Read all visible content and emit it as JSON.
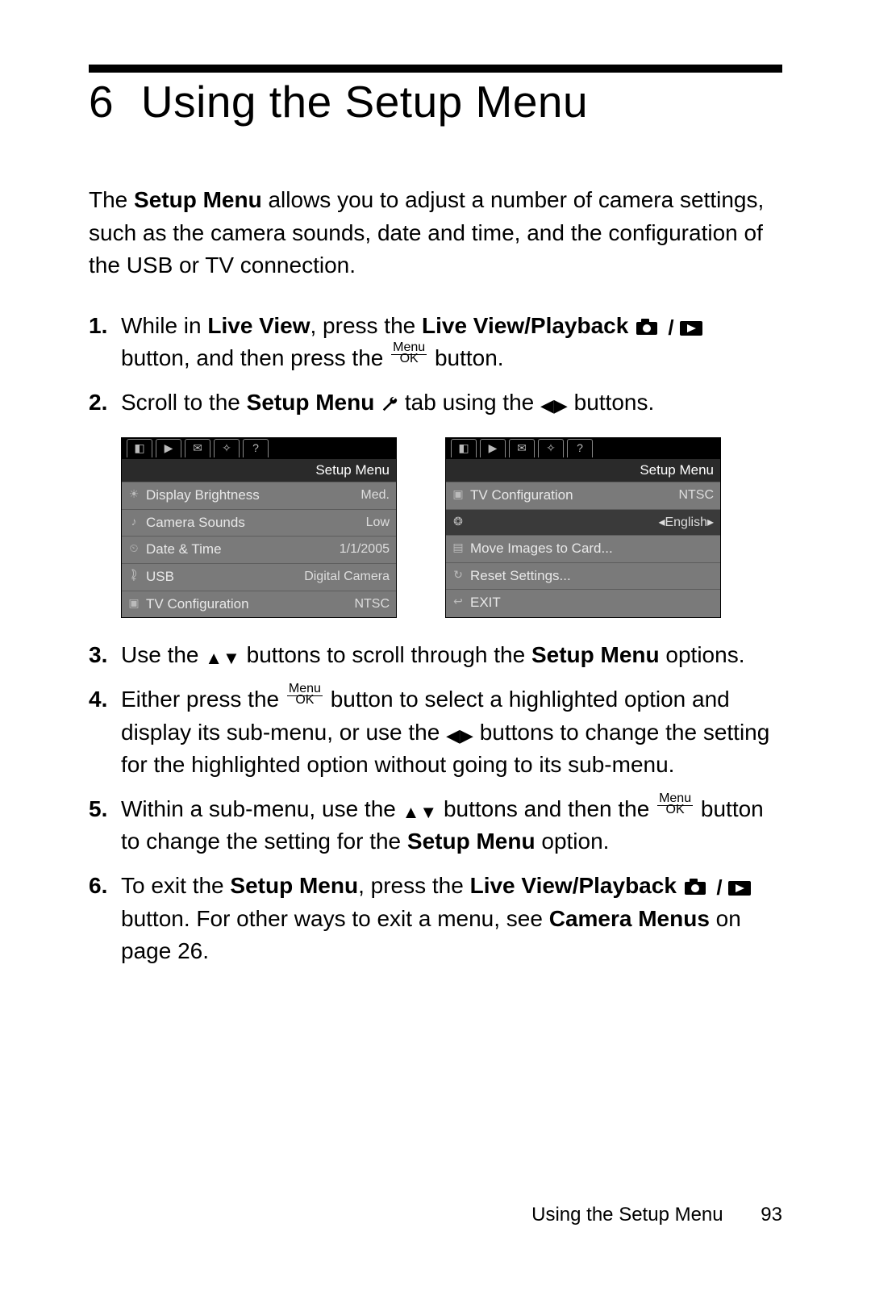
{
  "chapter_number": "6",
  "chapter_title": "Using the Setup Menu",
  "intro_text_pre": "The ",
  "intro_bold": "Setup Menu",
  "intro_text_post": " allows you to adjust a number of camera settings, such as the camera sounds, date and time, and the configuration of the USB or TV connection.",
  "steps": {
    "s1a": "While in ",
    "s1b": "Live View",
    "s1c": ", press the ",
    "s1d": "Live View/Playback",
    "s1e": " button, and then press the ",
    "s1f": " button.",
    "s2a": "Scroll to the ",
    "s2b": "Setup Menu",
    "s2c": " tab using the ",
    "s2d": " buttons.",
    "s3a": "Use the ",
    "s3b": " buttons to scroll through the ",
    "s3c": "Setup Menu",
    "s3d": " options.",
    "s4a": "Either press the ",
    "s4b": " button to select a highlighted option and display its sub-menu, or use the ",
    "s4c": " buttons to change the setting for the highlighted option without going to its sub-menu.",
    "s5a": "Within a sub-menu, use the ",
    "s5b": " buttons and then the ",
    "s5c": " button to change the setting for the ",
    "s5d": "Setup Menu",
    "s5e": " option.",
    "s6a": "To exit the ",
    "s6b": "Setup Menu",
    "s6c": ", press the ",
    "s6d": "Live View/Playback",
    "s6e": " button. For other ways to exit a menu, see ",
    "s6f": "Camera Menus",
    "s6g": " on page 26."
  },
  "menu_ok": {
    "top": "Menu",
    "bottom": "OK"
  },
  "screenshot_left": {
    "title": "Setup Menu",
    "rows": [
      {
        "label": "Display Brightness",
        "value": "Med."
      },
      {
        "label": "Camera Sounds",
        "value": "Low"
      },
      {
        "label": "Date & Time",
        "value": "1/1/2005"
      },
      {
        "label": "USB",
        "value": "Digital Camera"
      },
      {
        "label": "TV Configuration",
        "value": "NTSC"
      }
    ]
  },
  "screenshot_right": {
    "title": "Setup Menu",
    "rows": [
      {
        "label": "TV Configuration",
        "value": "NTSC"
      },
      {
        "label": "",
        "value": "◂English▸",
        "selected": true
      },
      {
        "label": "Move Images to Card...",
        "value": ""
      },
      {
        "label": "Reset Settings...",
        "value": ""
      },
      {
        "label": "EXIT",
        "value": ""
      }
    ]
  },
  "footer_text": "Using the Setup Menu",
  "page_number": "93"
}
